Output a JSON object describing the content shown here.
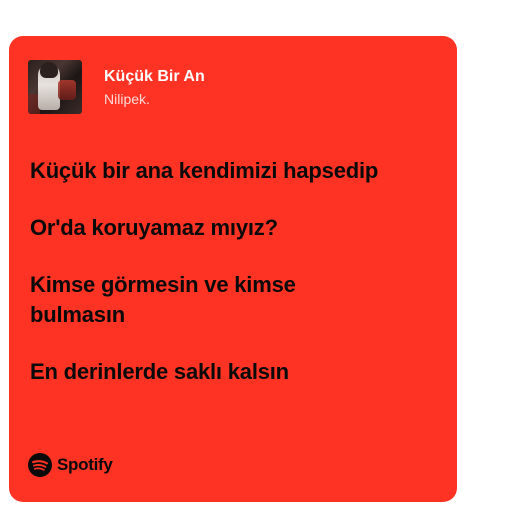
{
  "card": {
    "background_color": "#ff3323"
  },
  "track": {
    "title": "Küçük Bir An",
    "artist": "Nilipek."
  },
  "lyrics": [
    "Küçük bir ana kendimizi hapsedip",
    "Or'da koruyamaz mıyız?",
    "Kimse görmesin ve kimse bulmasın",
    "En derinlerde saklı kalsın"
  ],
  "brand": {
    "name": "Spotify",
    "icon": "spotify-icon"
  }
}
